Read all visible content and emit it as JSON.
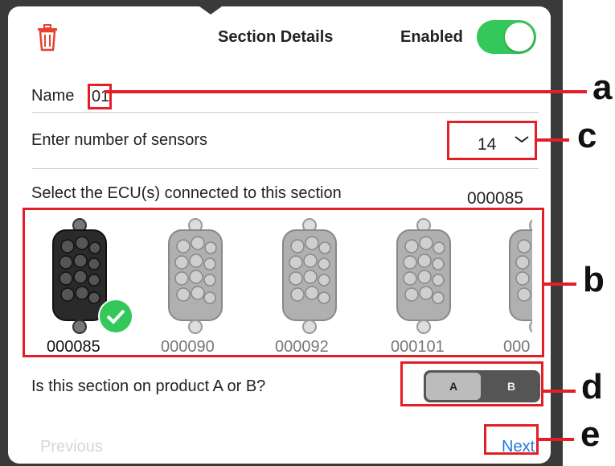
{
  "header": {
    "title": "Section Details",
    "enabled_label": "Enabled",
    "enabled": true
  },
  "name": {
    "label": "Name",
    "value": "01"
  },
  "sensors": {
    "label": "Enter number of sensors",
    "value": "14"
  },
  "ecu": {
    "label": "Select the ECU(s) connected to this section",
    "selected": "000085",
    "items": [
      {
        "id": "000085",
        "selected": true
      },
      {
        "id": "000090",
        "selected": false
      },
      {
        "id": "000092",
        "selected": false
      },
      {
        "id": "000101",
        "selected": false
      },
      {
        "id": "000",
        "selected": false
      }
    ]
  },
  "product": {
    "question": "Is this section on product A or B?",
    "options": [
      "A",
      "B"
    ],
    "selected": "A"
  },
  "footer": {
    "previous": "Previous",
    "next": "Next"
  },
  "callouts": [
    "a",
    "c",
    "b",
    "d",
    "e"
  ],
  "colors": {
    "accent_red": "#e41e26",
    "toggle_green": "#34c759",
    "link_blue": "#1e7ae0"
  }
}
